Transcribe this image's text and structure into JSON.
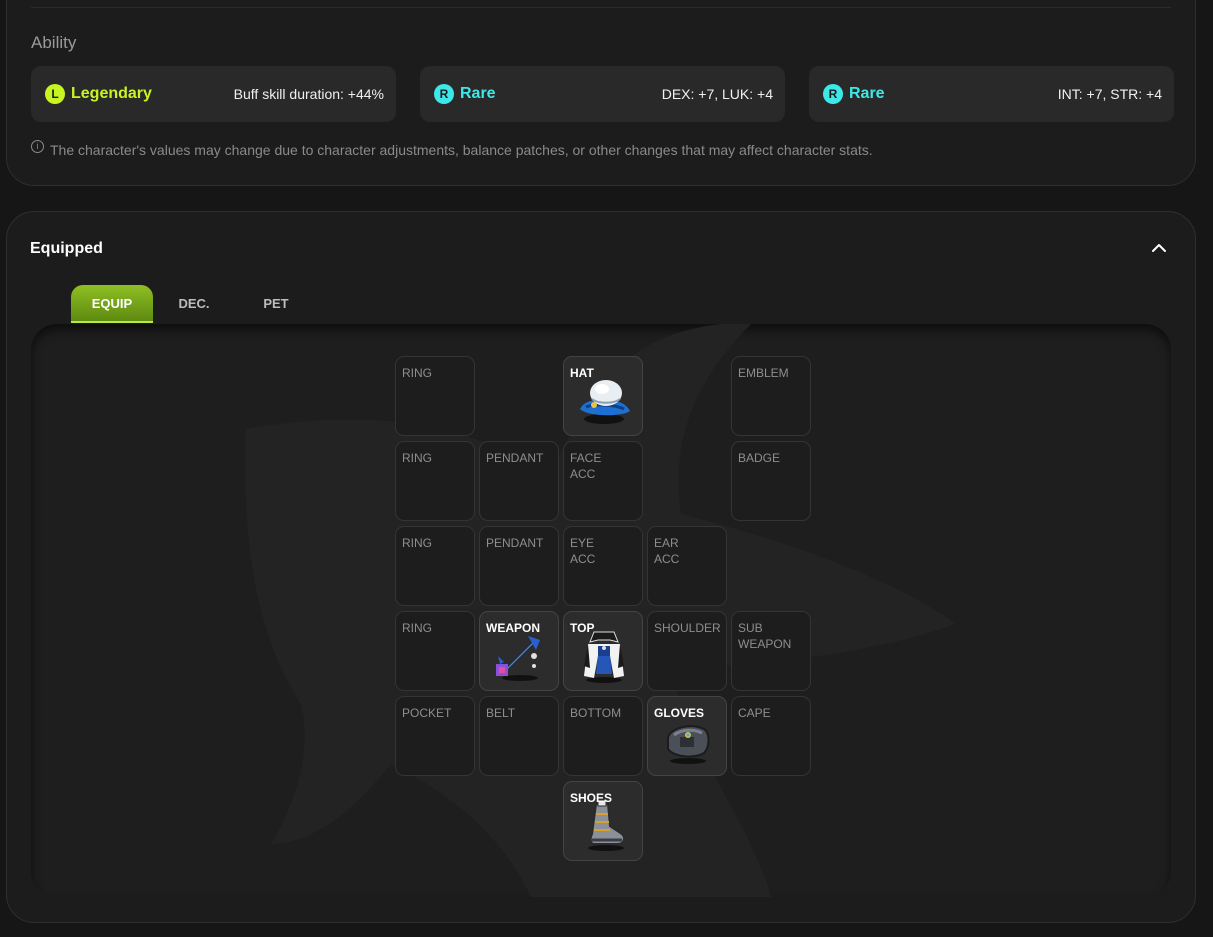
{
  "ability": {
    "title": "Ability",
    "lines": [
      {
        "grade": "Legendary",
        "badge": "L",
        "color": "#c8f522",
        "value": "Buff skill duration: +44%"
      },
      {
        "grade": "Rare",
        "badge": "R",
        "color": "#3ee8e8",
        "value": "DEX: +7, LUK: +4"
      },
      {
        "grade": "Rare",
        "badge": "R",
        "color": "#3ee8e8",
        "value": "INT: +7, STR: +4"
      }
    ],
    "notice": "The character's values may change due to character adjustments, balance patches, or other changes that may affect character stats."
  },
  "equipped": {
    "title": "Equipped",
    "tabs": [
      "EQUIP",
      "DEC.",
      "PET"
    ],
    "active_tab": "EQUIP",
    "slots": {
      "ring1": "RING",
      "hat": "HAT",
      "emblem": "EMBLEM",
      "ring2": "RING",
      "pendant1": "PENDANT",
      "face_acc": "FACE\nACC",
      "badge": "BADGE",
      "ring3": "RING",
      "pendant2": "PENDANT",
      "eye_acc": "EYE\nACC",
      "ear_acc": "EAR\nACC",
      "ring4": "RING",
      "weapon": "WEAPON",
      "top": "TOP",
      "shoulder": "SHOULDER",
      "sub_weapon": "SUB\nWEAPON",
      "pocket": "POCKET",
      "belt": "BELT",
      "bottom": "BOTTOM",
      "gloves": "GLOVES",
      "cape": "CAPE",
      "shoes": "SHOES"
    }
  }
}
